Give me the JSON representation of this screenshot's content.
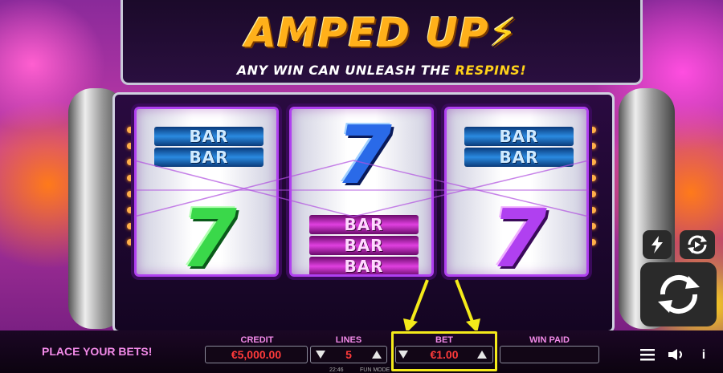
{
  "game": {
    "title": "AMPED UP",
    "title_bolt": "⚡",
    "subtitle_prefix": "ANY WIN CAN UNLEASH THE ",
    "subtitle_highlight": "RESPINS!"
  },
  "reels": [
    {
      "top": {
        "symbol": "BAR BAR",
        "bars": [
          "BAR",
          "BAR"
        ],
        "color": "blue"
      },
      "bottom": {
        "symbol": "7",
        "color": "green"
      }
    },
    {
      "top": {
        "symbol": "7",
        "color": "blue"
      },
      "bottom": {
        "symbol": "BAR BAR BAR",
        "bars": [
          "BAR",
          "BAR",
          "BAR"
        ],
        "color": "pink"
      }
    },
    {
      "top": {
        "symbol": "BAR BAR",
        "bars": [
          "BAR",
          "BAR"
        ],
        "color": "blue"
      },
      "bottom": {
        "symbol": "7",
        "color": "purple"
      }
    }
  ],
  "status": {
    "message": "PLACE YOUR BETS!"
  },
  "fields": {
    "credit": {
      "label": "CREDIT",
      "value": "€5,000.00"
    },
    "lines": {
      "label": "LINES",
      "value": "5"
    },
    "bet": {
      "label": "BET",
      "value": "€1.00"
    },
    "win_paid": {
      "label": "WIN PAID",
      "value": ""
    }
  },
  "footer": {
    "time": "22:46",
    "mode": "FUN MODE"
  },
  "controls": {
    "turbo_icon": "lightning-icon",
    "autoplay_icon": "autoplay-icon",
    "spin_icon": "spin-icon",
    "menu_icon": "menu-icon",
    "sound_icon": "sound-icon",
    "info_icon": "info-icon",
    "info_glyph": "i"
  },
  "colors": {
    "accent": "#f28ae8",
    "value_red": "#ff3a3a",
    "highlight": "#f4ea1a",
    "title": "#ffb01a"
  }
}
